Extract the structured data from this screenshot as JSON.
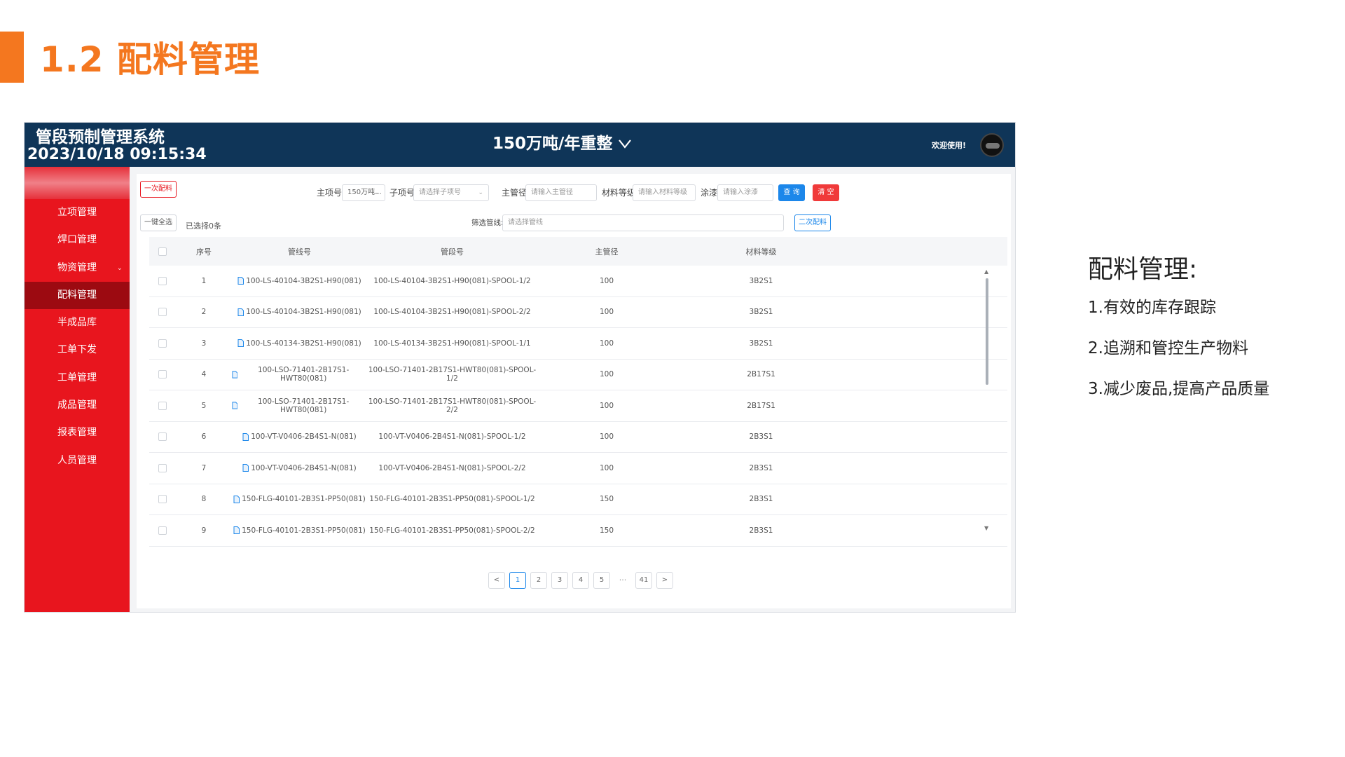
{
  "slide": {
    "title": "1.2 配料管理"
  },
  "header": {
    "system_name": "管段预制管理系统",
    "datetime": "2023/10/18 09:15:34",
    "project": "150万吨/年重整",
    "welcome": "欢迎使用!"
  },
  "sidebar": {
    "items": [
      {
        "label": "立项管理"
      },
      {
        "label": "焊口管理"
      },
      {
        "label": "物资管理",
        "caret": "⌄"
      },
      {
        "label": "配料管理"
      },
      {
        "label": "半成品库"
      },
      {
        "label": "工单下发"
      },
      {
        "label": "工单管理"
      },
      {
        "label": "成品管理"
      },
      {
        "label": "报表管理"
      },
      {
        "label": "人员管理"
      }
    ],
    "active_index": 3
  },
  "toolbar": {
    "first_batch_button": "一次配料",
    "main_item_label": "主项号:",
    "main_item_value": "150万吨...",
    "sub_item_label": "子项号:",
    "sub_item_placeholder": "请选择子项号",
    "main_diameter_label": "主管径:",
    "main_diameter_placeholder": "请输入主管径",
    "material_grade_label": "材料等级:",
    "material_grade_placeholder": "请输入材料等级",
    "coating_label": "涂漆:",
    "coating_placeholder": "请输入涂漆",
    "query_button": "查 询",
    "clear_button": "清 空",
    "select_all_button": "一键全选",
    "selected_count": "已选择0条",
    "filter_line_label": "筛选管线:",
    "filter_line_placeholder": "请选择管线",
    "second_batch_button": "二次配料"
  },
  "table": {
    "headers": {
      "index": "序号",
      "line_no": "管线号",
      "segment_no": "管段号",
      "main_diameter": "主管径",
      "material_grade": "材料等级"
    },
    "rows": [
      {
        "index": "1",
        "line_no": "100-LS-40104-3B2S1-H90(081)",
        "segment_no": "100-LS-40104-3B2S1-H90(081)-SPOOL-1/2",
        "main_diameter": "100",
        "material_grade": "3B2S1"
      },
      {
        "index": "2",
        "line_no": "100-LS-40104-3B2S1-H90(081)",
        "segment_no": "100-LS-40104-3B2S1-H90(081)-SPOOL-2/2",
        "main_diameter": "100",
        "material_grade": "3B2S1"
      },
      {
        "index": "3",
        "line_no": "100-LS-40134-3B2S1-H90(081)",
        "segment_no": "100-LS-40134-3B2S1-H90(081)-SPOOL-1/1",
        "main_diameter": "100",
        "material_grade": "3B2S1"
      },
      {
        "index": "4",
        "line_no": "100-LSO-71401-2B17S1-HWT80(081)",
        "segment_no": "100-LSO-71401-2B17S1-HWT80(081)-SPOOL-1/2",
        "main_diameter": "100",
        "material_grade": "2B17S1"
      },
      {
        "index": "5",
        "line_no": "100-LSO-71401-2B17S1-HWT80(081)",
        "segment_no": "100-LSO-71401-2B17S1-HWT80(081)-SPOOL-2/2",
        "main_diameter": "100",
        "material_grade": "2B17S1"
      },
      {
        "index": "6",
        "line_no": "100-VT-V0406-2B4S1-N(081)",
        "segment_no": "100-VT-V0406-2B4S1-N(081)-SPOOL-1/2",
        "main_diameter": "100",
        "material_grade": "2B3S1"
      },
      {
        "index": "7",
        "line_no": "100-VT-V0406-2B4S1-N(081)",
        "segment_no": "100-VT-V0406-2B4S1-N(081)-SPOOL-2/2",
        "main_diameter": "100",
        "material_grade": "2B3S1"
      },
      {
        "index": "8",
        "line_no": "150-FLG-40101-2B3S1-PP50(081)",
        "segment_no": "150-FLG-40101-2B3S1-PP50(081)-SPOOL-1/2",
        "main_diameter": "150",
        "material_grade": "2B3S1"
      },
      {
        "index": "9",
        "line_no": "150-FLG-40101-2B3S1-PP50(081)",
        "segment_no": "150-FLG-40101-2B3S1-PP50(081)-SPOOL-2/2",
        "main_diameter": "150",
        "material_grade": "2B3S1"
      }
    ]
  },
  "pagination": {
    "prev": "<",
    "pages": [
      "1",
      "2",
      "3",
      "4",
      "5"
    ],
    "ellipsis": "···",
    "last": "41",
    "next": ">",
    "current": "1"
  },
  "notes": {
    "title": "配料管理:",
    "items": [
      "1.有效的库存跟踪",
      "2.追溯和管控生产物料",
      "3.减少废品,提高产品质量"
    ]
  },
  "colors": {
    "accent_orange": "#f4771f",
    "header_navy": "#0f3558",
    "sidebar_red": "#e8151e",
    "sidebar_active": "#9c0a11",
    "primary_blue": "#1c87ea",
    "danger_red": "#f03a3a"
  },
  "icons": {
    "project_dropdown": "chevron-down-icon",
    "line_file": "file-icon"
  }
}
